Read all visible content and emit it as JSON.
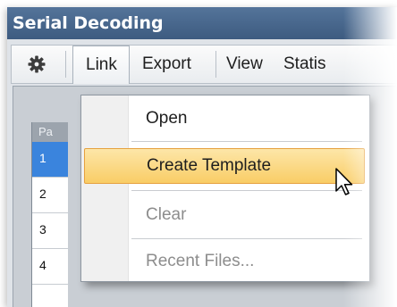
{
  "window": {
    "title": "Serial Decoding"
  },
  "toolbar": {
    "settings_icon": "gear-icon",
    "menus": [
      "Link",
      "Export",
      "View",
      "Statis"
    ]
  },
  "grid": {
    "header": "Pa",
    "rows": [
      "1",
      "2",
      "3",
      "4"
    ],
    "selected_row": "1"
  },
  "dropdown": {
    "items": [
      {
        "label": "Open",
        "enabled": true
      },
      {
        "label": "Create Template",
        "enabled": true,
        "highlighted": true
      },
      {
        "label": "Clear",
        "enabled": false
      },
      {
        "label": "Recent Files...",
        "enabled": false
      }
    ]
  },
  "colors": {
    "title_bar": "#48678d",
    "selection": "#3a84dd",
    "menu_highlight": "#fbd780",
    "disabled_text": "#8d8d8d"
  }
}
